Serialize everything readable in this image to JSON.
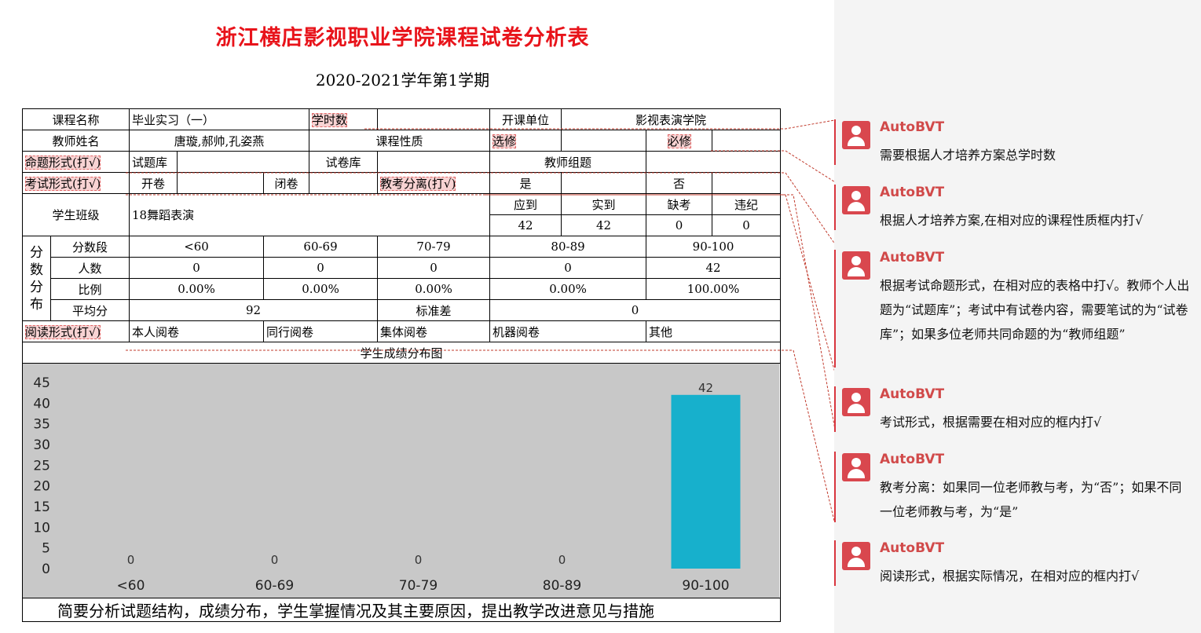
{
  "document": {
    "title": "浙江横店影视职业学院课程试卷分析表",
    "term": "2020-2021学年第1学期"
  },
  "info": {
    "course_name_label": "课程名称",
    "course_name": "毕业实习（一）",
    "hours_label": "学时数",
    "hours": "",
    "dept_label": "开课单位",
    "dept": "影视表演学院",
    "teacher_label": "教师姓名",
    "teacher": "唐璇,郝帅,孔姿燕",
    "nature_label": "课程性质",
    "elective_label": "选修",
    "required_label": "必修",
    "question_form_label": "命题形式(打√)",
    "question_bank": "试题库",
    "paper_bank": "试卷库",
    "teacher_group": "教师组题",
    "exam_form_label": "考试形式(打√)",
    "open_book": "开卷",
    "closed_book": "闭卷",
    "separation_label": "教考分离(打√)",
    "yes": "是",
    "no": "否",
    "class_label": "学生班级",
    "class_name": "18舞蹈表演",
    "due_label": "应到",
    "actual_label": "实到",
    "absent_label": "缺考",
    "violation_label": "违纪",
    "due": "42",
    "actual": "42",
    "absent": "0",
    "violation": "0"
  },
  "distribution": {
    "section_label": "分数分布",
    "band_label": "分数段",
    "bands": [
      "<60",
      "60-69",
      "70-79",
      "80-89",
      "90-100"
    ],
    "count_label": "人数",
    "counts": [
      "0",
      "0",
      "0",
      "0",
      "42"
    ],
    "ratio_label": "比例",
    "ratios": [
      "0.00%",
      "0.00%",
      "0.00%",
      "0.00%",
      "100.00%"
    ],
    "avg_label": "平均分",
    "avg": "92",
    "std_label": "标准差",
    "std": "0"
  },
  "reading": {
    "label": "阅读形式(打√)",
    "self": "本人阅卷",
    "peer": "同行阅卷",
    "group": "集体阅卷",
    "machine": "机器阅卷",
    "other": "其他"
  },
  "chart_title": "学生成绩分布图",
  "footer": "简要分析试题结构，成绩分布，学生掌握情况及其主要原因，提出教学改进意见与措施",
  "chart_data": {
    "type": "bar",
    "categories": [
      "<60",
      "60-69",
      "70-79",
      "80-89",
      "90-100"
    ],
    "values": [
      0,
      0,
      0,
      0,
      42
    ],
    "data_labels": [
      "0",
      "0",
      "0",
      "0",
      "42"
    ],
    "yticks": [
      "0",
      "5",
      "10",
      "15",
      "20",
      "25",
      "30",
      "35",
      "40",
      "45"
    ],
    "ylim": [
      0,
      45
    ],
    "bar_color": "#17b0cc",
    "background": "#c8c8c8",
    "grid": false
  },
  "comments": [
    {
      "author": "AutoBVT",
      "text": "需要根据人才培养方案总学时数"
    },
    {
      "author": "AutoBVT",
      "text": "根据人才培养方案,在相对应的课程性质框内打√"
    },
    {
      "author": "AutoBVT",
      "text": "根据考试命题形式，在相对应的表格中打√。教师个人出题为“试题库”；考试中有试卷内容，需要笔试的为“试卷库”；如果多位老师共同命题的为“教师组题”"
    },
    {
      "author": "AutoBVT",
      "text": "考试形式，根据需要在相对应的框内打√"
    },
    {
      "author": "AutoBVT",
      "text": "教考分离：如果同一位老师教与考，为“否”；如果不同一位老师教与考，为“是”"
    },
    {
      "author": "AutoBVT",
      "text": "阅读形式，根据实际情况，在相对应的框内打√"
    }
  ],
  "colors": {
    "title": "#e8141b",
    "comment_accent": "#d9363e",
    "highlight": "#f8d3d3"
  }
}
